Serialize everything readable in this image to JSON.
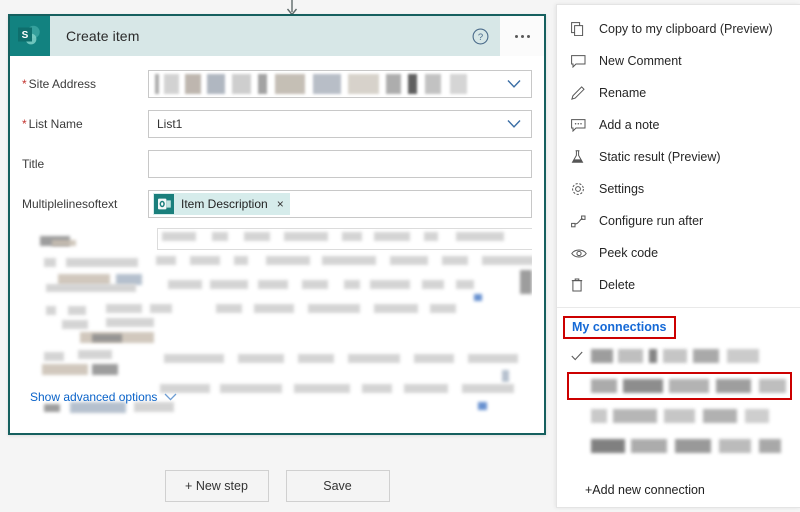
{
  "card": {
    "title": "Create item",
    "logo_icon": "sharepoint-logo-icon",
    "help_icon": "help-circle-icon",
    "ellipsis_icon": "ellipsis-icon",
    "incoming_arrow_icon": "arrow-down-icon",
    "border_color": "#16605f",
    "header_color": "#d7e7e7",
    "fields": [
      {
        "label": "Site Address",
        "required": true,
        "value": "",
        "redacted": true,
        "has_dropdown": true
      },
      {
        "label": "List Name",
        "required": true,
        "value": "List1",
        "redacted": false,
        "has_dropdown": true
      },
      {
        "label": "Title",
        "required": false,
        "value": "",
        "redacted": false,
        "has_dropdown": false
      },
      {
        "label": "Multiplelinesoftext",
        "required": false,
        "value": "",
        "redacted": false,
        "has_dropdown": false
      }
    ],
    "token": {
      "label": "Item Description",
      "remove_label": "×",
      "icon": "outlook-item-icon"
    },
    "advanced_options": {
      "label": "Show advanced options",
      "chevron_icon": "chevron-down-icon",
      "color": "#0a63c9"
    }
  },
  "bottom_bar": {
    "buttons": [
      {
        "label": "+ New step",
        "name": "new-step-button"
      },
      {
        "label": "Save",
        "name": "save-button"
      }
    ]
  },
  "menu": {
    "items": [
      {
        "label": "Copy to my clipboard (Preview)",
        "icon": "copy-icon"
      },
      {
        "label": "New Comment",
        "icon": "comment-icon"
      },
      {
        "label": "Rename",
        "icon": "pencil-icon"
      },
      {
        "label": "Add a note",
        "icon": "note-icon"
      },
      {
        "label": "Static result (Preview)",
        "icon": "flask-icon"
      },
      {
        "label": "Settings",
        "icon": "gear-icon"
      },
      {
        "label": "Configure run after",
        "icon": "run-after-icon"
      },
      {
        "label": "Peek code",
        "icon": "eye-icon"
      },
      {
        "label": "Delete",
        "icon": "trash-icon"
      }
    ],
    "connections_header": {
      "label": "My connections",
      "text_color": "#1569d6",
      "highlight_color": "#cc0000"
    },
    "connections": [
      {
        "selected": true,
        "redacted": true,
        "highlighted": false,
        "check_icon": "check-icon"
      },
      {
        "selected": false,
        "redacted": true,
        "highlighted": true,
        "check_icon": ""
      },
      {
        "selected": false,
        "redacted": true,
        "highlighted": false,
        "check_icon": ""
      },
      {
        "selected": false,
        "redacted": true,
        "highlighted": false,
        "check_icon": ""
      }
    ],
    "add_connection": {
      "label": "+Add new connection"
    }
  }
}
